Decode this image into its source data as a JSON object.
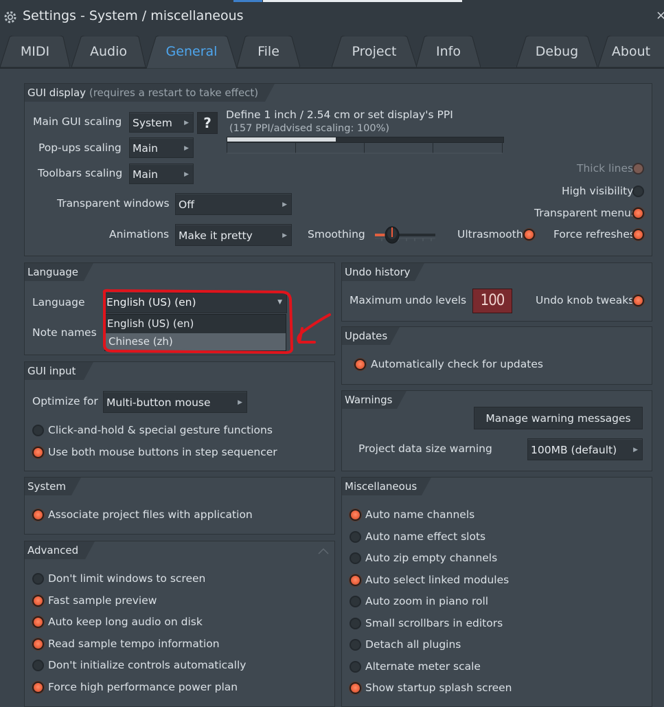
{
  "window": {
    "title": "Settings - System / miscellaneous",
    "close": "×"
  },
  "tabs": [
    {
      "label": "MIDI"
    },
    {
      "label": "Audio"
    },
    {
      "label": "General",
      "active": true
    },
    {
      "label": "File"
    },
    {
      "label": "Project"
    },
    {
      "label": "Info"
    },
    {
      "label": "Debug"
    },
    {
      "label": "About"
    }
  ],
  "gui_display": {
    "title": "GUI display",
    "subtitle": "(requires a restart to take effect)",
    "main_scaling_label": "Main GUI scaling",
    "main_scaling_value": "System",
    "help_label": "?",
    "popups_label": "Pop-ups scaling",
    "popups_value": "Main",
    "toolbars_label": "Toolbars scaling",
    "toolbars_value": "Main",
    "ppi_line1": "Define 1 inch / 2.54 cm or set display's PPI",
    "ppi_line2": "(157 PPI/advised scaling: 100%)",
    "transparent_windows_label": "Transparent windows",
    "transparent_windows_value": "Off",
    "animations_label": "Animations",
    "animations_value": "Make it pretty",
    "smoothing_label": "Smoothing",
    "thick_lines": "Thick lines",
    "high_visibility": "High visibility",
    "transparent_menus": "Transparent menus",
    "ultrasmooth": "Ultrasmooth",
    "force_refreshes": "Force refreshes"
  },
  "language": {
    "title": "Language",
    "language_label": "Language",
    "language_value": "English (US) (en)",
    "note_names_label": "Note names",
    "options": [
      "English (US) (en)",
      "Chinese (zh)"
    ]
  },
  "undo": {
    "title": "Undo history",
    "max_levels_label": "Maximum undo levels",
    "max_levels_value": "100",
    "knob_tweaks": "Undo knob tweaks"
  },
  "updates": {
    "title": "Updates",
    "auto_check": "Automatically check for updates"
  },
  "gui_input": {
    "title": "GUI input",
    "optimize_label": "Optimize for",
    "optimize_value": "Multi-button mouse",
    "click_hold": "Click-and-hold & special gesture functions",
    "both_buttons": "Use both mouse buttons in step sequencer"
  },
  "warnings": {
    "title": "Warnings",
    "manage_button": "Manage warning messages",
    "data_size_label": "Project data size warning",
    "data_size_value": "100MB (default)"
  },
  "system": {
    "title": "System",
    "associate": "Associate project files with application"
  },
  "advanced": {
    "title": "Advanced",
    "items": [
      {
        "label": "Don't limit windows to screen",
        "on": false
      },
      {
        "label": "Fast sample preview",
        "on": true
      },
      {
        "label": "Auto keep long audio on disk",
        "on": true
      },
      {
        "label": "Read sample tempo information",
        "on": true
      },
      {
        "label": "Don't initialize controls automatically",
        "on": false
      },
      {
        "label": "Force high performance power plan",
        "on": true
      }
    ]
  },
  "misc": {
    "title": "Miscellaneous",
    "items": [
      {
        "label": "Auto name channels",
        "on": true
      },
      {
        "label": "Auto name effect slots",
        "on": false
      },
      {
        "label": "Auto zip empty channels",
        "on": false
      },
      {
        "label": "Auto select linked modules",
        "on": true
      },
      {
        "label": "Auto zoom in piano roll",
        "on": false
      },
      {
        "label": "Small scrollbars in editors",
        "on": false
      },
      {
        "label": "Detach all plugins",
        "on": false
      },
      {
        "label": "Alternate meter scale",
        "on": false
      },
      {
        "label": "Show startup splash screen",
        "on": true
      }
    ]
  },
  "colors": {
    "accent": "#4ea6ee",
    "radio_on": "#f26a45",
    "annotation": "#e0141c",
    "undo_bg": "#7a2a2e"
  }
}
